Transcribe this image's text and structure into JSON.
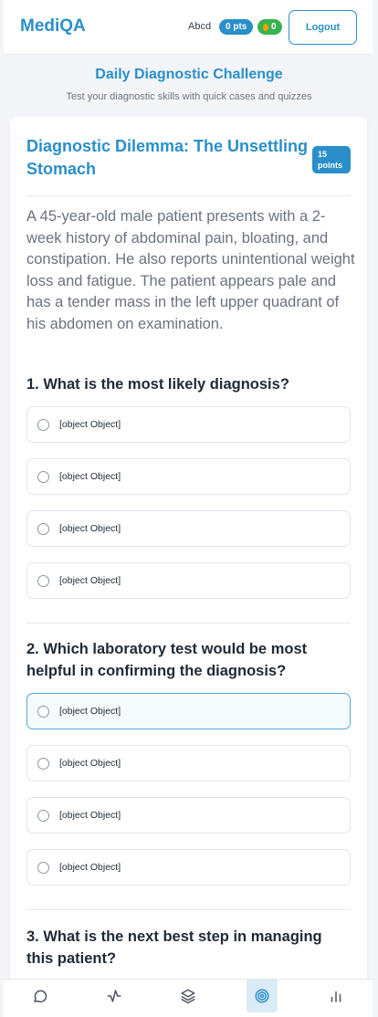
{
  "header": {
    "logo": "MediQA",
    "username": "Abcd",
    "points_badge": "0 pts",
    "streak_count": "0",
    "logout_label": "Logout"
  },
  "page": {
    "title": "Daily Diagnostic Challenge",
    "subtitle": "Test your diagnostic skills with quick cases and quizzes"
  },
  "case": {
    "title": "Diagnostic Dilemma: The Unsettling Stomach",
    "points_label": "15 points",
    "description": "A 45-year-old male patient presents with a 2-week history of abdominal pain, bloating, and constipation. He also reports unintentional weight loss and fatigue. The patient appears pale and has a tender mass in the left upper quadrant of his abdomen on examination."
  },
  "questions": [
    {
      "text": "1. What is the most likely diagnosis?",
      "options": [
        "[object Object]",
        "[object Object]",
        "[object Object]",
        "[object Object]"
      ],
      "selected_index": null
    },
    {
      "text": "2. Which laboratory test would be most helpful in confirming the diagnosis?",
      "options": [
        "[object Object]",
        "[object Object]",
        "[object Object]",
        "[object Object]"
      ],
      "selected_index": 0
    },
    {
      "text": "3. What is the next best step in managing this patient?",
      "options": [],
      "selected_index": null
    }
  ],
  "nav": {
    "items": [
      {
        "icon": "chat-icon"
      },
      {
        "icon": "activity-icon"
      },
      {
        "icon": "layers-icon"
      },
      {
        "icon": "target-icon",
        "active": true
      },
      {
        "icon": "bar-chart-icon"
      }
    ]
  },
  "colors": {
    "primary": "#2a8fc9",
    "streak": "#37b24d",
    "active_nav_bg": "#dbeaf4"
  }
}
